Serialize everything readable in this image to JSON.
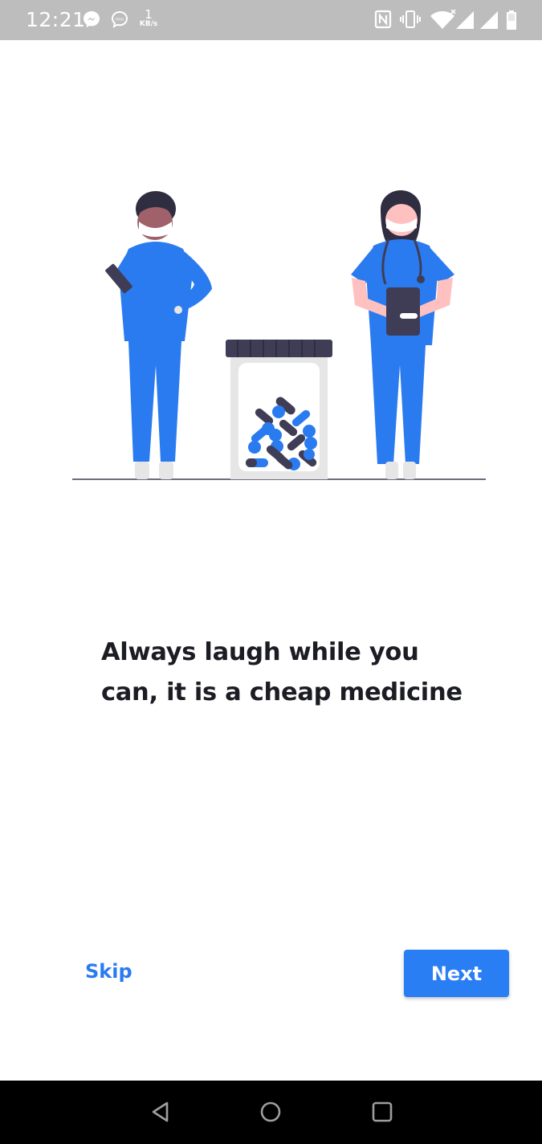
{
  "status_bar": {
    "time": "12:21",
    "net_speed_value": "1",
    "net_speed_unit": "KB/s",
    "left_icons": [
      "messenger-icon",
      "imo-icon"
    ],
    "right_icons": [
      "nfc-icon",
      "vibrate-icon",
      "wifi-icon",
      "signal-icon",
      "signal-icon",
      "battery-icon"
    ]
  },
  "onboarding": {
    "illustration": "doctors-and-pill-jar",
    "headline_line1": "Always laugh while you",
    "headline_line2": "can, it is a cheap medicine",
    "skip_label": "Skip",
    "next_label": "Next"
  },
  "colors": {
    "accent": "#2a7ef4",
    "scrubs": "#2b7bf0",
    "dark": "#3a3a4a",
    "headline": "#1c1c24"
  },
  "nav_bar": {
    "buttons": [
      "back-icon",
      "home-icon",
      "recents-icon"
    ]
  }
}
